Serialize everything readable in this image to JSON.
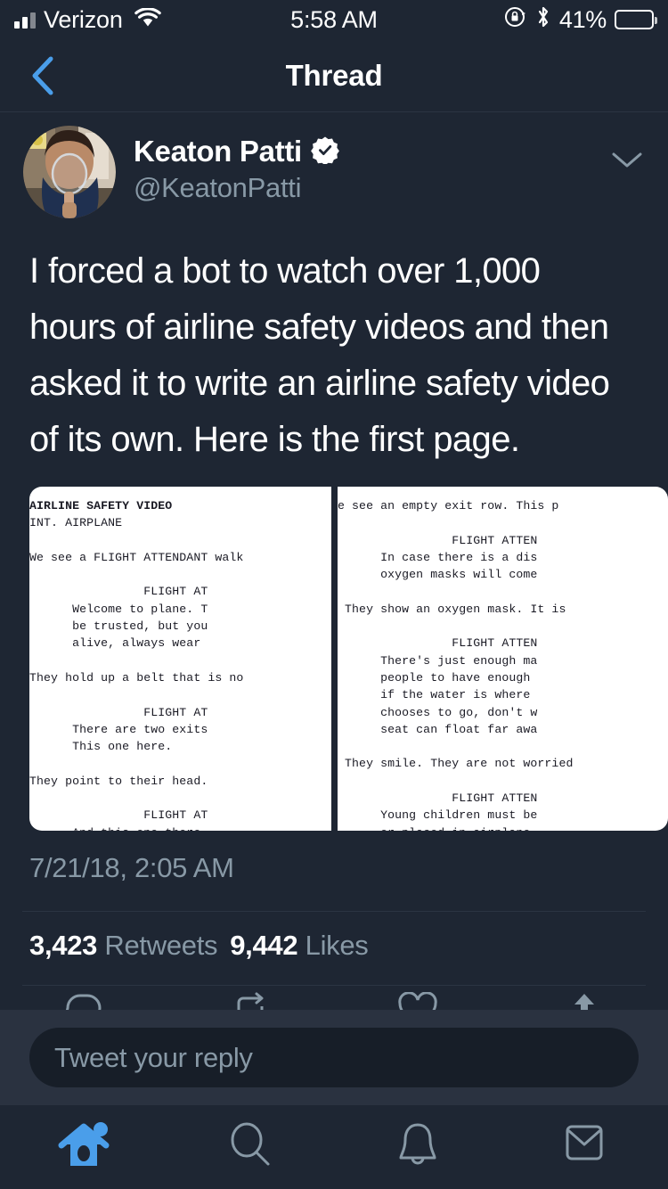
{
  "status_bar": {
    "carrier": "Verizon",
    "time": "5:58 AM",
    "battery_percent": "41%",
    "battery_level": 41,
    "icons": [
      "signal-bars-icon",
      "wifi-icon",
      "rotation-lock-icon",
      "bluetooth-icon",
      "battery-icon"
    ]
  },
  "nav": {
    "title": "Thread",
    "back_icon": "chevron-left-icon",
    "accent_color": "#4a9eea"
  },
  "tweet": {
    "display_name": "Keaton Patti",
    "verified": true,
    "handle": "@KeatonPatti",
    "caret_icon": "chevron-down-icon",
    "text": "I forced a bot to watch over 1,000 hours of airline safety videos and then asked it to write an airline safety video of its own. Here is the first page.",
    "timestamp": "7/21/18, 2:05 AM",
    "retweets_count": "3,423",
    "retweets_label": "Retweets",
    "likes_count": "9,442",
    "likes_label": "Likes",
    "actions": [
      "reply-icon",
      "retweet-icon",
      "like-icon",
      "share-icon"
    ]
  },
  "media": {
    "page_left": "AIRLINE SAFETY VIDEO",
    "page_left_body": "INT. AIRPLANE\n\nWe see a FLIGHT ATTENDANT walk\n\n                FLIGHT AT\n      Welcome to plane. T\n      be trusted, but you\n      alive, always wear \n\nThey hold up a belt that is no\n\n                FLIGHT AT\n      There are two exits\n      This one here.\n\nThey point to their head.\n\n                FLIGHT AT\n      And this one there.\n\nThey point nowhere.\n\n                FLIGHT AT\n      If you are seated i\n      you are now the pil",
    "page_right_body": "We see an empty exit row. This p\n\n                 FLIGHT ATTEN\n       In case there is a dis\n       oxygen masks will come\n\n  They show an oxygen mask. It is \n\n                 FLIGHT ATTEN\n       There's just enough ma\n       people to have enough \n       if the water is where \n       chooses to go, don't w\n       seat can float far awa\n\n  They smile. They are not worried\n\n                 FLIGHT ATTEN\n       Young children must be\n       or placed in airplane \n\n  They hold up a child. They switc\n\n                 FLIGHT ATTEN\n       Flying is illegal. So "
  },
  "reply": {
    "placeholder": "Tweet your reply"
  },
  "tab_bar": {
    "items": [
      {
        "name": "home",
        "icon": "home-icon",
        "active": true,
        "badge": true
      },
      {
        "name": "search",
        "icon": "search-icon",
        "active": false,
        "badge": false
      },
      {
        "name": "notifications",
        "icon": "bell-icon",
        "active": false,
        "badge": false
      },
      {
        "name": "messages",
        "icon": "envelope-icon",
        "active": false,
        "badge": false
      }
    ],
    "active_color": "#4a9eea",
    "inactive_color": "#8899a6"
  }
}
